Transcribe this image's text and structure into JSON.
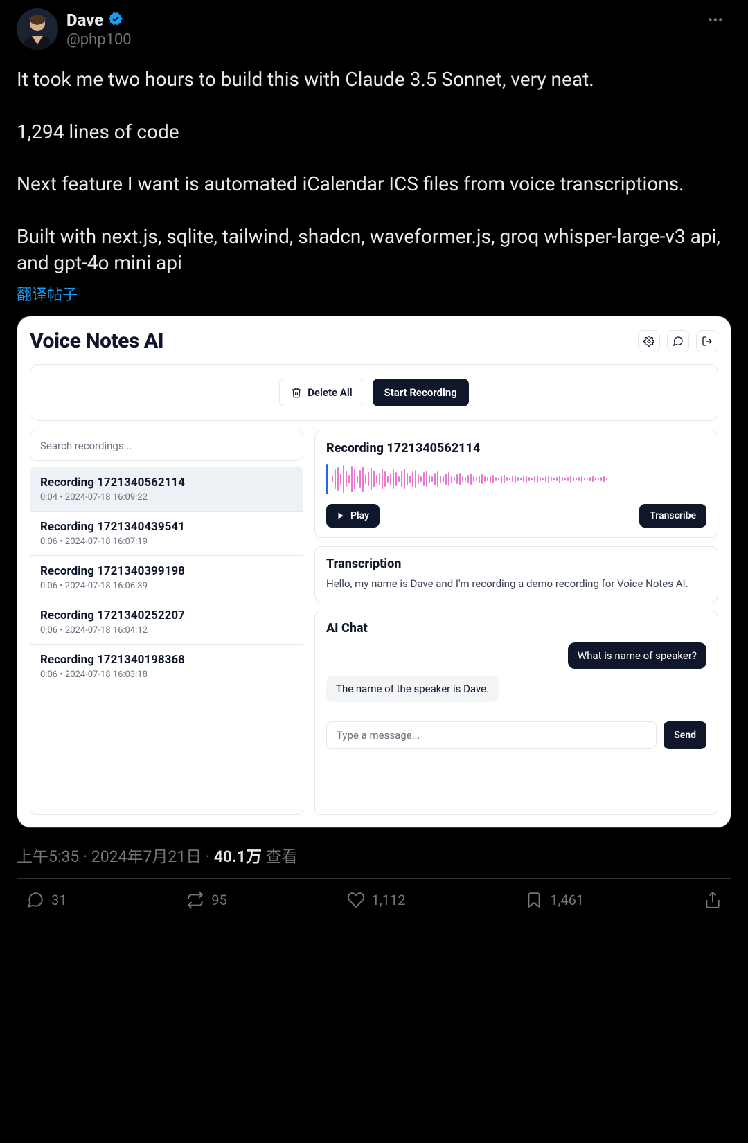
{
  "user": {
    "display_name": "Dave",
    "handle": "@php100"
  },
  "tweet": {
    "text": "It took me two hours to build this with Claude 3.5 Sonnet, very neat.\n\n1,294 lines of code\n\nNext feature I want is automated iCalendar ICS files from voice transcriptions.\n\nBuilt with next.js, sqlite, tailwind, shadcn, waveformer.js, groq whisper-large-v3 api, and gpt-4o mini api",
    "translate_label": "翻译帖子"
  },
  "app": {
    "title": "Voice Notes AI",
    "toolbar": {
      "delete_all": "Delete All",
      "start_recording": "Start Recording"
    },
    "search": {
      "placeholder": "Search recordings..."
    },
    "recordings": [
      {
        "title": "Recording 1721340562114",
        "sub": "0:04  •  2024-07-18 16:09:22",
        "active": true
      },
      {
        "title": "Recording 1721340439541",
        "sub": "0:06  •  2024-07-18 16:07:19",
        "active": false
      },
      {
        "title": "Recording 1721340399198",
        "sub": "0:06  •  2024-07-18 16:06:39",
        "active": false
      },
      {
        "title": "Recording 1721340252207",
        "sub": "0:06  •  2024-07-18 16:04:12",
        "active": false
      },
      {
        "title": "Recording 1721340198368",
        "sub": "0:06  •  2024-07-18 16:03:18",
        "active": false
      }
    ],
    "detail": {
      "title": "Recording 1721340562114",
      "play": "Play",
      "transcribe": "Transcribe"
    },
    "transcription": {
      "heading": "Transcription",
      "text": "Hello, my name is Dave and I'm recording a demo recording for Voice Notes AI."
    },
    "chat": {
      "heading": "AI Chat",
      "user_msg": "What is name of speaker?",
      "ai_msg": "The name of the speaker is Dave.",
      "placeholder": "Type a message...",
      "send": "Send"
    },
    "waveform": [
      8,
      28,
      34,
      16,
      40,
      22,
      12,
      38,
      30,
      10,
      26,
      36,
      14,
      20,
      32,
      24,
      12,
      18,
      30,
      22,
      10,
      16,
      28,
      20,
      8,
      24,
      30,
      18,
      10,
      22,
      26,
      14,
      8,
      20,
      24,
      12,
      8,
      18,
      22,
      10,
      8,
      16,
      20,
      10,
      6,
      14,
      18,
      8,
      6,
      12,
      16,
      8,
      6,
      10,
      14,
      8,
      6,
      10,
      12,
      6,
      4,
      10,
      12,
      6,
      4,
      8,
      10,
      6,
      4,
      8,
      10,
      6,
      4,
      8,
      10,
      6,
      4,
      8,
      10,
      6,
      4,
      6,
      10,
      6,
      4,
      6,
      10,
      6,
      4,
      6,
      8,
      4,
      2,
      6,
      8,
      4,
      2,
      6,
      8,
      4
    ]
  },
  "meta": {
    "time": "上午5:35",
    "sep1": " · ",
    "date": "2024年7月21日",
    "sep2": " · ",
    "views_count": "40.1万",
    "views_label": " 查看"
  },
  "actions": {
    "replies": "31",
    "retweets": "95",
    "likes": "1,112",
    "bookmarks": "1,461"
  }
}
